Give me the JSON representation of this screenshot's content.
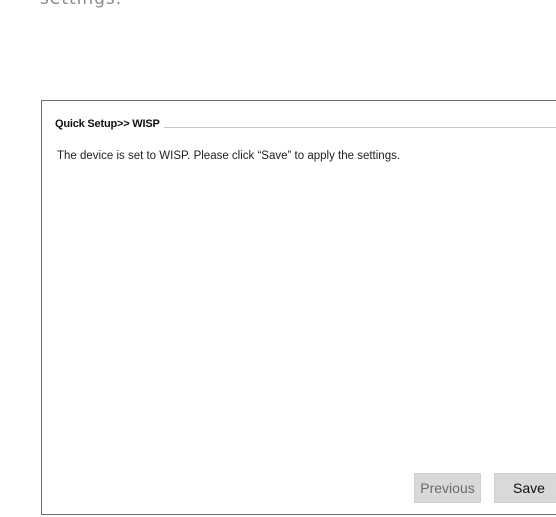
{
  "top_text": "settings.",
  "panel": {
    "title": "Quick Setup>> WISP",
    "message": "The device is set to WISP.  Please click  “Save”  to apply the settings."
  },
  "buttons": {
    "previous_label": "Previous",
    "save_label": "Save"
  }
}
